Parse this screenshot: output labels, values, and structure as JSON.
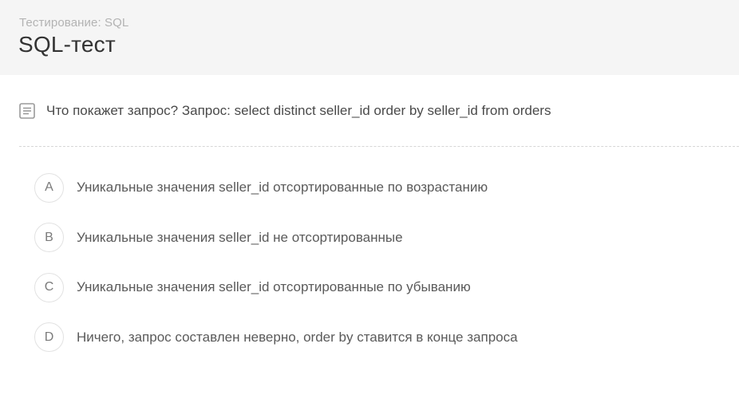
{
  "header": {
    "breadcrumb": "Тестирование: SQL",
    "title": "SQL-тест"
  },
  "question": {
    "icon": "question-list-icon",
    "text": "Что покажет запрос? Запрос: select distinct seller_id order by seller_id from orders"
  },
  "answers": [
    {
      "letter": "A",
      "text": "Уникальные значения seller_id отсортированные по возрастанию"
    },
    {
      "letter": "B",
      "text": "Уникальные значения seller_id не отсортированные"
    },
    {
      "letter": "C",
      "text": "Уникальные значения seller_id отсортированные по убыванию"
    },
    {
      "letter": "D",
      "text": "Ничего, запрос составлен неверно, order by ставится в конце запроса"
    }
  ],
  "colors": {
    "header_bg": "#f5f5f5",
    "title": "#333333",
    "breadcrumb": "#b3b3b3",
    "circle_border": "#e2e2e2"
  }
}
